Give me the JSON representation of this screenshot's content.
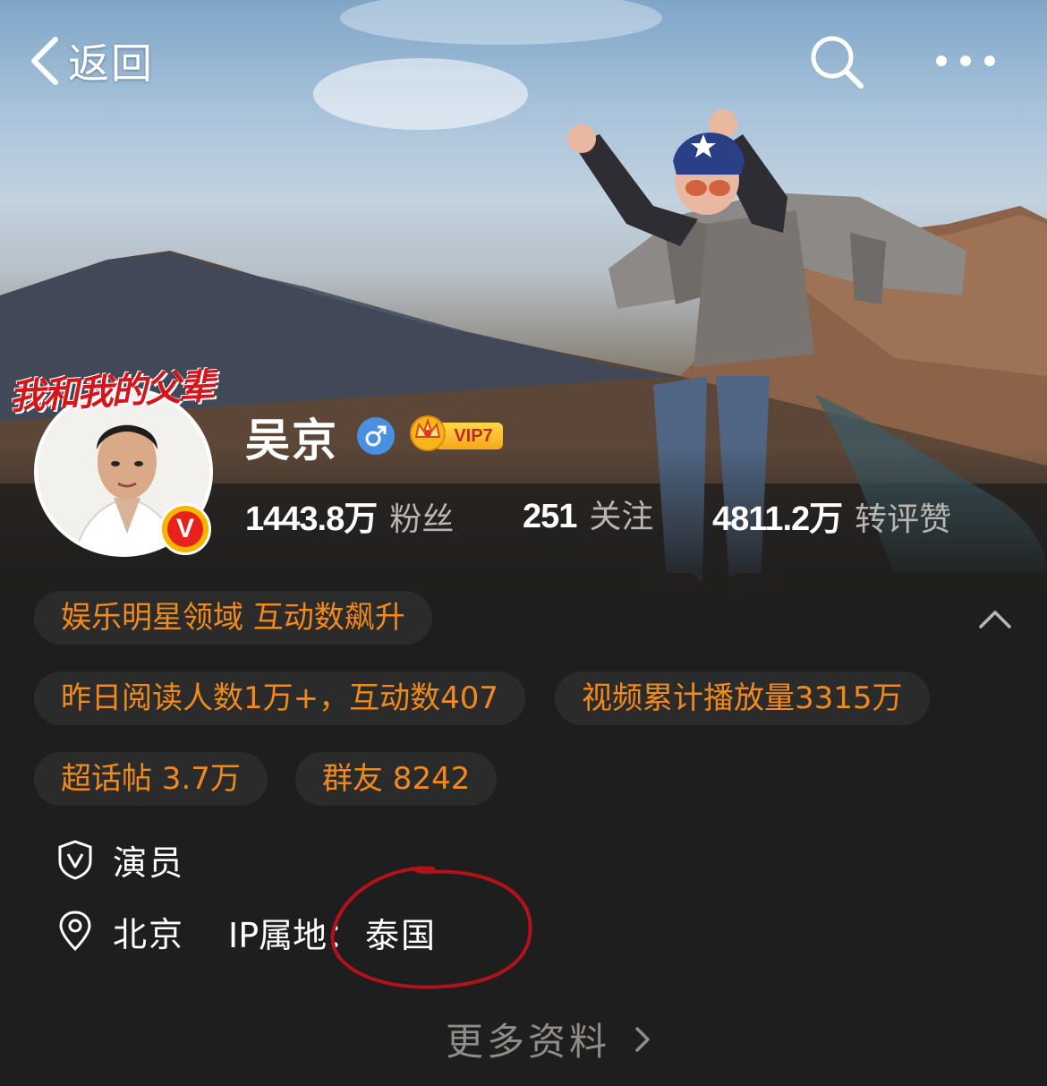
{
  "header": {
    "back_label": "返回",
    "icons": {
      "back": "chevron-left-icon",
      "search": "search-icon",
      "more": "more-icon"
    }
  },
  "profile": {
    "name": "吴京",
    "gender": "male",
    "vip_label": "VIP7",
    "avatar_banner_text": "我和我的父辈",
    "verified_mark": "V",
    "stats": [
      {
        "num": "1443.8万",
        "label": "粉丝"
      },
      {
        "num": "251",
        "label": "关注"
      },
      {
        "num": "4811.2万",
        "label": "转评赞"
      }
    ]
  },
  "badges": {
    "domain": "娱乐明星领域 互动数飙升",
    "reads": "昨日阅读人数1万+，互动数407",
    "video": "视频累计播放量3315万",
    "super_topic": "超话帖 3.7万",
    "group": "群友 8242"
  },
  "info": {
    "occupation": "演员",
    "location": "北京",
    "ip_label": "IP属地：",
    "ip_value": "泰国"
  },
  "more_label": "更多资料",
  "colors": {
    "accent_orange": "#f08a1e",
    "background": "#1e1e1e",
    "pill_bg": "#2b2b2b",
    "annotation_red": "#b3121b",
    "vip_gold": "#f4a817"
  }
}
